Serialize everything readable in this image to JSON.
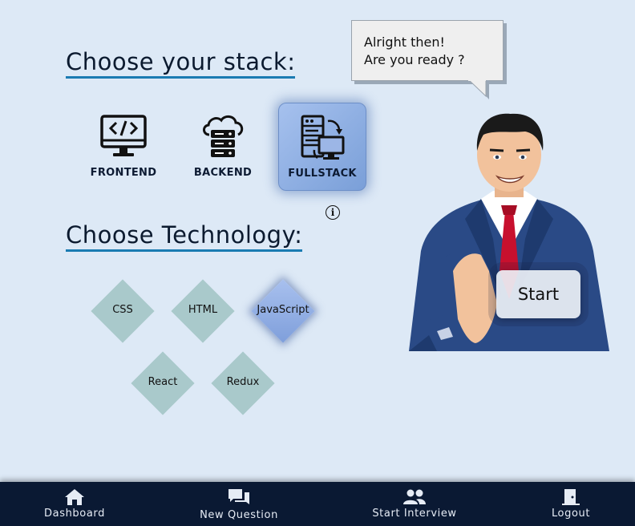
{
  "headings": {
    "stack": "Choose your stack:",
    "technology": "Choose Technology:"
  },
  "stacks": [
    {
      "label": "FRONTEND",
      "icon": "monitor-code-icon",
      "selected": false
    },
    {
      "label": "BACKEND",
      "icon": "cloud-server-icon",
      "selected": false
    },
    {
      "label": "FULLSTACK",
      "icon": "server-monitor-sync-icon",
      "selected": true
    }
  ],
  "technologies": [
    {
      "label": "CSS",
      "selected": false
    },
    {
      "label": "HTML",
      "selected": false
    },
    {
      "label": "JavaScript",
      "selected": true
    },
    {
      "label": "React",
      "selected": false
    },
    {
      "label": "Redux",
      "selected": false
    }
  ],
  "info_icon": "info-icon",
  "speech": {
    "line1": "Alright then!",
    "line2": "Are you ready ?"
  },
  "start_button": "Start",
  "nav": [
    {
      "label": "Dashboard",
      "icon": "home-icon"
    },
    {
      "label": "New Question",
      "icon": "chat-icon"
    },
    {
      "label": "Start Interview",
      "icon": "people-icon"
    },
    {
      "label": "Logout",
      "icon": "door-exit-icon"
    }
  ],
  "colors": {
    "background": "#dde9f6",
    "heading_underline": "#1a7bb2",
    "tech_diamond": "#a9c9cb",
    "selected_gradient_start": "#a6c1ee",
    "selected_gradient_end": "#7a9fd8",
    "nav_background": "#0a1933"
  }
}
